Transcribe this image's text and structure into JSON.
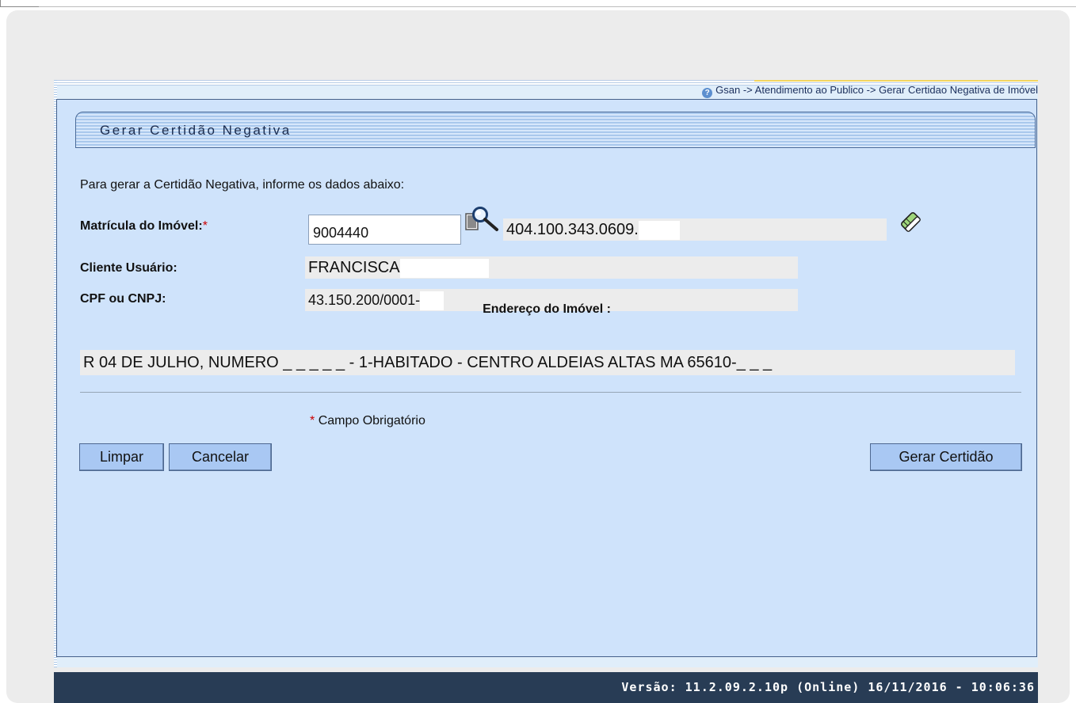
{
  "breadcrumb": "Gsan -> Atendimento ao Publico -> Gerar Certidao Negativa de Imóvel",
  "form": {
    "title": "Gerar Certidão Negativa",
    "intro": "Para gerar a Certidão Negativa, informe os dados abaixo:",
    "matricula_label": "Matrícula do Imóvel:",
    "required_mark": "*",
    "matricula_value": "9004440",
    "inscricao": "404.100.343.0609.",
    "cliente_label": "Cliente Usuário:",
    "cliente_value": "FRANCISCA",
    "cpf_label": "CPF ou CNPJ:",
    "cpf_value": "43.150.200/0001-",
    "endereco_label": "Endereço do Imóvel :",
    "endereco_value": "R 04 DE JULHO, NUMERO _ _ _ _ _  - 1-HABITADO - CENTRO ALDEIAS ALTAS MA 65610-_ _ _",
    "required_note": "Campo Obrigatório"
  },
  "buttons": {
    "limpar": "Limpar",
    "cancelar": "Cancelar",
    "gerar": "Gerar Certidão"
  },
  "footer": "Versão: 11.2.09.2.10p (Online) 16/11/2016 - 10:06:36",
  "icons": {
    "search": "magnifier-search-icon",
    "clear": "eraser-icon",
    "help": "help-icon"
  },
  "colors": {
    "panel": "#cfe3fb",
    "button": "#a9c8f3",
    "footer": "#283c55",
    "required": "#cc0000"
  }
}
